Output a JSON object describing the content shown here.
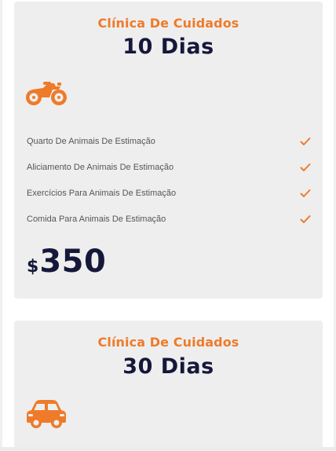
{
  "plans": [
    {
      "subtitle": "Clínica De Cuidados",
      "title": "10 Dias",
      "icon": "motorcycle-icon",
      "features": [
        {
          "label": "Quarto De Animais De Estimação",
          "icon": "check-icon"
        },
        {
          "label": "Aliciamento De Animais De Estimação",
          "icon": "check-icon"
        },
        {
          "label": "Exercícios Para Animais De Estimação",
          "icon": "check-icon"
        },
        {
          "label": "Comida Para Animais De Estimação",
          "icon": "check-icon"
        }
      ],
      "price": {
        "currency": "$",
        "amount": "350"
      }
    },
    {
      "subtitle": "Clínica De Cuidados",
      "title": "30 Dias",
      "icon": "car-icon"
    }
  ],
  "colors": {
    "accent": "#ee7b2a",
    "title": "#15183a",
    "card_background": "#eeeeee",
    "feature_text": "#555555"
  }
}
